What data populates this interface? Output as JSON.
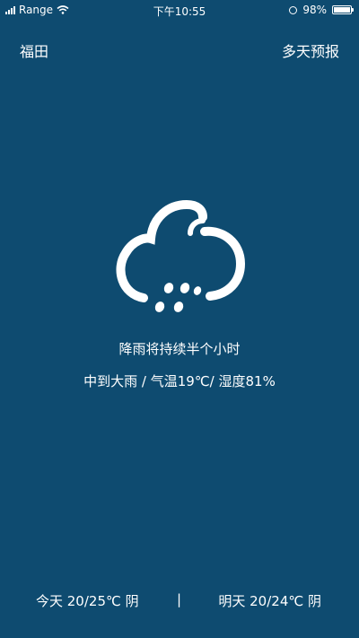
{
  "status_bar": {
    "carrier": "Range",
    "time": "下午10:55",
    "battery": "98%",
    "battery_level": 0.98
  },
  "header": {
    "city": "福田",
    "forecast_link": "多天预报"
  },
  "current": {
    "icon": "heavy-rain-cloud-icon",
    "headline": "降雨将持续半个小时",
    "detail": "中到大雨 / 气温19℃/ 湿度81%"
  },
  "footer": {
    "today": "今天 20/25℃ 阴",
    "divider": "|",
    "tomorrow": "明天 20/24℃ 阴"
  },
  "colors": {
    "background": "#0e4b70",
    "foreground": "#ffffff"
  }
}
